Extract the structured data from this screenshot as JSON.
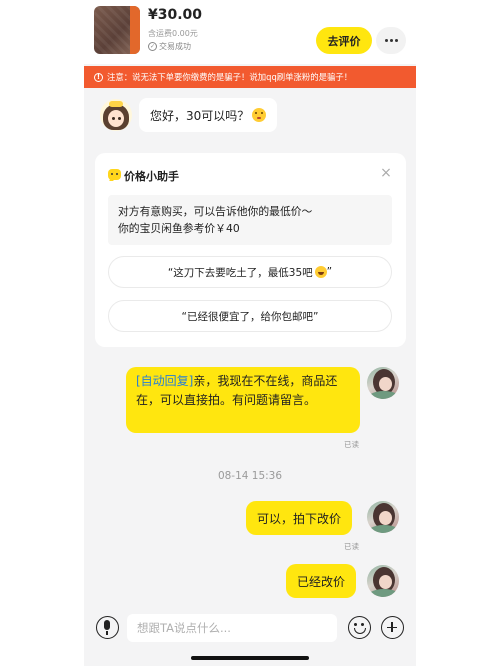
{
  "header": {
    "price": "¥30.00",
    "shipping": "含运费0.00元",
    "deal_status": "交易成功",
    "review_button": "去评价"
  },
  "warning": {
    "text": "注意：说无法下单要你缴费的是骗子！说加qq刷单涨粉的是骗子！"
  },
  "messages": {
    "buyer_offer": "您好，30可以吗？",
    "auto_reply_tag": "[自动回复]",
    "auto_reply_text": "亲，我现在不在线，商品还在，可以直接拍。有问题请留言。",
    "reply_1": "可以，拍下改价",
    "reply_2": "已经改价",
    "read_label": "已读",
    "timestamp": "08-14 15:36"
  },
  "assistant": {
    "title": "价格小助手",
    "close": "×",
    "info_line1": "对方有意购买，可以告诉他你的最低价～",
    "info_line2": "你的宝贝闲鱼参考价￥40",
    "option_1": "“这刀下去要吃土了，最低35吧",
    "option_1_end": "”",
    "option_2": "“已经很便宜了，给你包邮吧”"
  },
  "input": {
    "placeholder": "想跟TA说点什么..."
  }
}
